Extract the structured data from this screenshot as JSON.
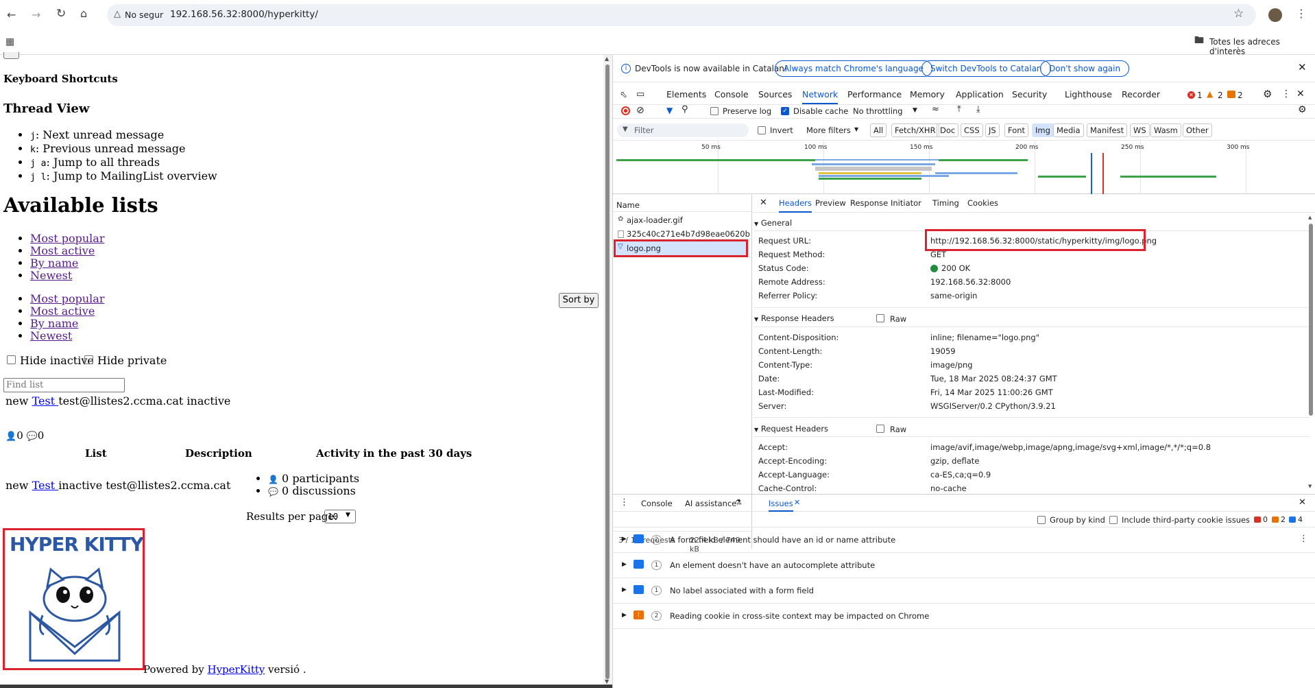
{
  "browser": {
    "security": "No segur",
    "url": "192.168.56.32:8000/hyperkitty/",
    "bookmarks_label": "Totes les adreces d'interès"
  },
  "page": {
    "keyboard_shortcuts": "Keyboard Shortcuts",
    "thread_view": "Thread View",
    "shortcuts": [
      {
        "key": "j",
        "text": ": Next unread message"
      },
      {
        "key": "k",
        "text": ": Previous unread message"
      },
      {
        "key": "j a",
        "text": ": Jump to all threads"
      },
      {
        "key": "j l",
        "text": ": Jump to MailingList overview"
      }
    ],
    "available_lists": "Available lists",
    "sort_links": [
      "Most popular",
      "Most active",
      "By name",
      "Newest"
    ],
    "sort_button": "Sort by",
    "hide_inactive": "Hide inactive",
    "hide_private": "Hide private",
    "find_placeholder": "Find list",
    "row1": {
      "prefix": "new ",
      "link": "Test ",
      "rest": "test@llistes2.ccma.cat inactive"
    },
    "counts": {
      "users": "0",
      "chats": "0"
    },
    "table_headers": [
      "List",
      "Description",
      "Activity in the past 30 days"
    ],
    "row2": {
      "prefix": "new ",
      "link": "Test ",
      "rest": "inactive test@llistes2.ccma.cat"
    },
    "participants": "0 participants",
    "discussions": "0 discussions",
    "results_per_page": "Results per page:",
    "per_page_value": "10",
    "logo_text": "HYPER KITTY",
    "powered_by": "Powered by ",
    "powered_link": "HyperKitty",
    "powered_suffix": " versió ."
  },
  "devtools": {
    "banner_text": "DevTools is now available in Catalan!",
    "banner_buttons": [
      "Always match Chrome's language",
      "Switch DevTools to Catalan",
      "Don't show again"
    ],
    "tabs": [
      "Elements",
      "Console",
      "Sources",
      "Network",
      "Performance",
      "Memory",
      "Application",
      "Security",
      "Lighthouse",
      "Recorder"
    ],
    "active_tab": "Network",
    "badges": {
      "errors": "1",
      "warnings": "2",
      "info": "2"
    },
    "toolbar": {
      "preserve_log": "Preserve log",
      "disable_cache": "Disable cache",
      "throttling": "No throttling"
    },
    "filter": {
      "placeholder": "Filter",
      "invert": "Invert",
      "more_filters": "More filters",
      "types": [
        "All",
        "Fetch/XHR",
        "Doc",
        "CSS",
        "JS",
        "Font",
        "Img",
        "Media",
        "Manifest",
        "WS",
        "Wasm",
        "Other"
      ],
      "active_type": "Img"
    },
    "timeline_ticks": [
      "50 ms",
      "100 ms",
      "150 ms",
      "200 ms",
      "250 ms",
      "300 ms"
    ],
    "name_header": "Name",
    "requests": [
      "ajax-loader.gif",
      "325c40c271e4b7d98eae0620b...",
      "logo.png"
    ],
    "status_bar": {
      "requests": "3 / 14 requests",
      "size": "22.4 kB / 749 kB"
    },
    "detail_tabs": [
      "Headers",
      "Preview",
      "Response",
      "Initiator",
      "Timing",
      "Cookies"
    ],
    "general_title": "General",
    "general": [
      {
        "k": "Request URL:",
        "v": "http://192.168.56.32:8000/static/hyperkitty/img/logo.png"
      },
      {
        "k": "Request Method:",
        "v": "GET"
      },
      {
        "k": "Status Code:",
        "v": "200 OK"
      },
      {
        "k": "Remote Address:",
        "v": "192.168.56.32:8000"
      },
      {
        "k": "Referrer Policy:",
        "v": "same-origin"
      }
    ],
    "response_title": "Response Headers",
    "raw": "Raw",
    "response": [
      {
        "k": "Content-Disposition:",
        "v": "inline; filename=\"logo.png\""
      },
      {
        "k": "Content-Length:",
        "v": "19059"
      },
      {
        "k": "Content-Type:",
        "v": "image/png"
      },
      {
        "k": "Date:",
        "v": "Tue, 18 Mar 2025 08:24:37 GMT"
      },
      {
        "k": "Last-Modified:",
        "v": "Fri, 14 Mar 2025 11:00:26 GMT"
      },
      {
        "k": "Server:",
        "v": "WSGIServer/0.2 CPython/3.9.21"
      }
    ],
    "request_title": "Request Headers",
    "request": [
      {
        "k": "Accept:",
        "v": "image/avif,image/webp,image/apng,image/svg+xml,image/*,*/*;q=0.8"
      },
      {
        "k": "Accept-Encoding:",
        "v": "gzip, deflate"
      },
      {
        "k": "Accept-Language:",
        "v": "ca-ES,ca;q=0.9"
      },
      {
        "k": "Cache-Control:",
        "v": "no-cache"
      }
    ],
    "drawer_tabs": [
      "Console",
      "AI assistance",
      "Issues"
    ],
    "issues_bar": {
      "group_by_kind": "Group by kind",
      "include_third_party": "Include third-party cookie issues",
      "counts": [
        "0",
        "2",
        "4"
      ]
    },
    "issues": [
      {
        "count": "2",
        "text": "A form field element should have an id or name attribute"
      },
      {
        "count": "1",
        "text": "An element doesn't have an autocomplete attribute"
      },
      {
        "count": "1",
        "text": "No label associated with a form field"
      },
      {
        "count": "2",
        "text": "Reading cookie in cross-site context may be impacted on Chrome"
      }
    ]
  }
}
